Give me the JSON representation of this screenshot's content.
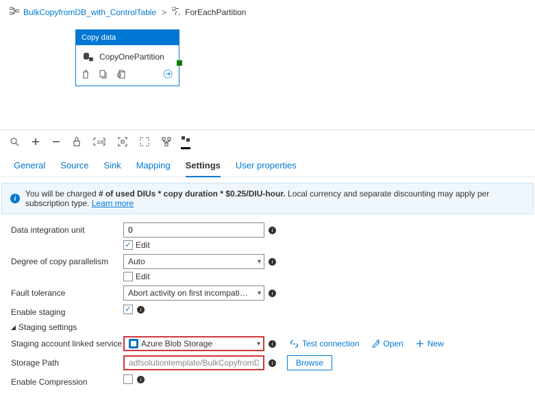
{
  "breadcrumb": {
    "parent": "BulkCopyfromDB_with_ControlTable",
    "current": "ForEachPartition"
  },
  "activity": {
    "type_label": "Copy data",
    "name": "CopyOnePartition"
  },
  "tabs": {
    "general": "General",
    "source": "Source",
    "sink": "Sink",
    "mapping": "Mapping",
    "settings": "Settings",
    "user_properties": "User properties"
  },
  "info": {
    "prefix": "You will be charged ",
    "bold": "# of used DIUs * copy duration * $0.25/DIU-hour.",
    "suffix": " Local currency and separate discounting may apply per subscription type. ",
    "link": "Learn more"
  },
  "form": {
    "diu_label": "Data integration unit",
    "diu_value": "0",
    "edit_label": "Edit",
    "parallel_label": "Degree of copy parallelism",
    "parallel_value": "Auto",
    "fault_label": "Fault tolerance",
    "fault_value": "Abort activity on first incompatible row",
    "staging_label": "Enable staging",
    "staging_section": "Staging settings",
    "ls_label": "Staging account linked service",
    "ls_value": "Azure Blob Storage",
    "test_conn": "Test connection",
    "open": "Open",
    "new": "New",
    "path_label": "Storage Path",
    "path_value": "adfsolutiontemplate/BulkCopyfromDB_with_ControlTable",
    "browse": "Browse",
    "compress_label": "Enable Compression"
  }
}
